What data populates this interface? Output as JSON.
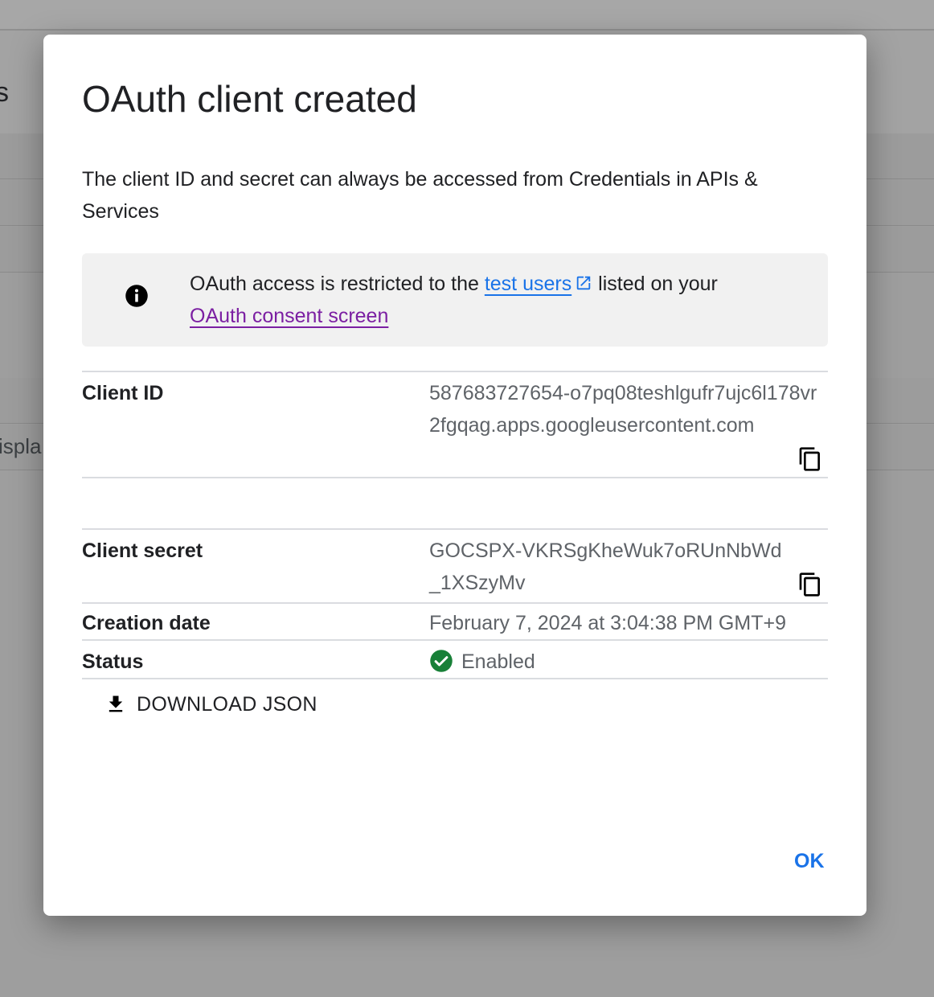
{
  "background": {
    "header_fragment": "s",
    "cell_fragment": "ispla"
  },
  "dialog": {
    "title": "OAuth client created",
    "description": "The client ID and secret can always be accessed from Credentials in APIs & Services",
    "info": {
      "icon": "info-icon",
      "text_before": "OAuth access is restricted to the ",
      "link_test_users": "test users",
      "text_after": " listed on your ",
      "link_consent_screen": "OAuth consent screen"
    },
    "details": {
      "client_id": {
        "label": "Client ID",
        "value": "587683727654-o7pq08teshlgufr7ujc6l178vr2fgqag.apps.googleusercontent.com"
      },
      "client_secret": {
        "label": "Client secret",
        "value": "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"
      },
      "creation_date": {
        "label": "Creation date",
        "value": "February 7, 2024 at 3:04:38 PM GMT+9"
      },
      "status": {
        "label": "Status",
        "value": "Enabled"
      }
    },
    "download_label": "DOWNLOAD JSON",
    "ok_label": "OK"
  },
  "colors": {
    "link": "#1a73e8",
    "visited_link": "#7b1fa2",
    "status_enabled": "#188038",
    "ok_button": "#1a73e8"
  }
}
